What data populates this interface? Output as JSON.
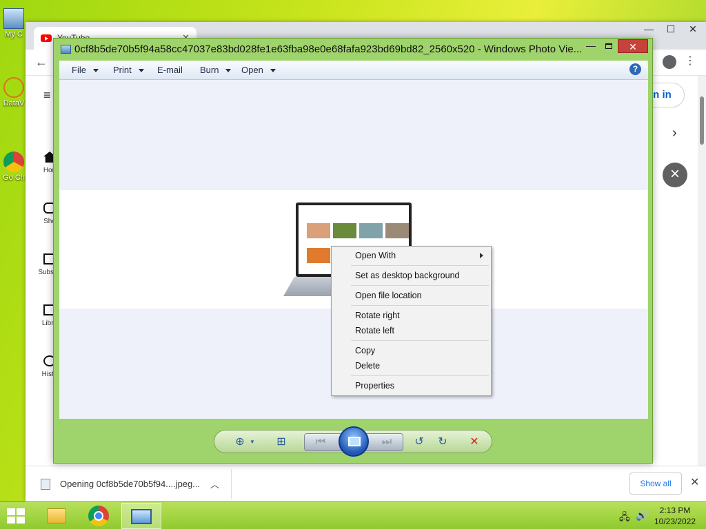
{
  "desktop": {
    "icons": [
      {
        "label": "My C"
      },
      {
        "label": "DataV"
      },
      {
        "label": "Go Ch"
      }
    ]
  },
  "chrome": {
    "tab_title": "YouTube",
    "sidebar": [
      {
        "label": "Hon"
      },
      {
        "label": "Sho"
      },
      {
        "label": "Subscri"
      },
      {
        "label": "Libra"
      },
      {
        "label": "Histo"
      }
    ],
    "signin_label": "gn in",
    "download": {
      "file_label": "Opening 0cf8b5de70b5f94....jpeg...",
      "show_all": "Show all"
    }
  },
  "photo_viewer": {
    "title": "0cf8b5de70b5f94a58cc47037e83bd028fe1e63fba98e0e68fafa923bd69bd82_2560x520 - Windows Photo Vie...",
    "menu": [
      {
        "label": "File"
      },
      {
        "label": "Print"
      },
      {
        "label": "E-mail"
      },
      {
        "label": "Burn"
      },
      {
        "label": "Open"
      }
    ],
    "help": "?"
  },
  "context_menu": {
    "items": [
      {
        "label": "Open With",
        "submenu": true
      },
      {
        "label": "Set as desktop background"
      },
      {
        "label": "Open file location"
      },
      {
        "label": "Rotate right"
      },
      {
        "label": "Rotate left"
      },
      {
        "label": "Copy"
      },
      {
        "label": "Delete"
      },
      {
        "label": "Properties"
      }
    ]
  },
  "taskbar": {
    "time": "2:13 PM",
    "date": "10/23/2022"
  },
  "colors": {
    "viewer_frame": "#9fd36b",
    "close_red": "#c7423a",
    "link_blue": "#1a73e8"
  }
}
